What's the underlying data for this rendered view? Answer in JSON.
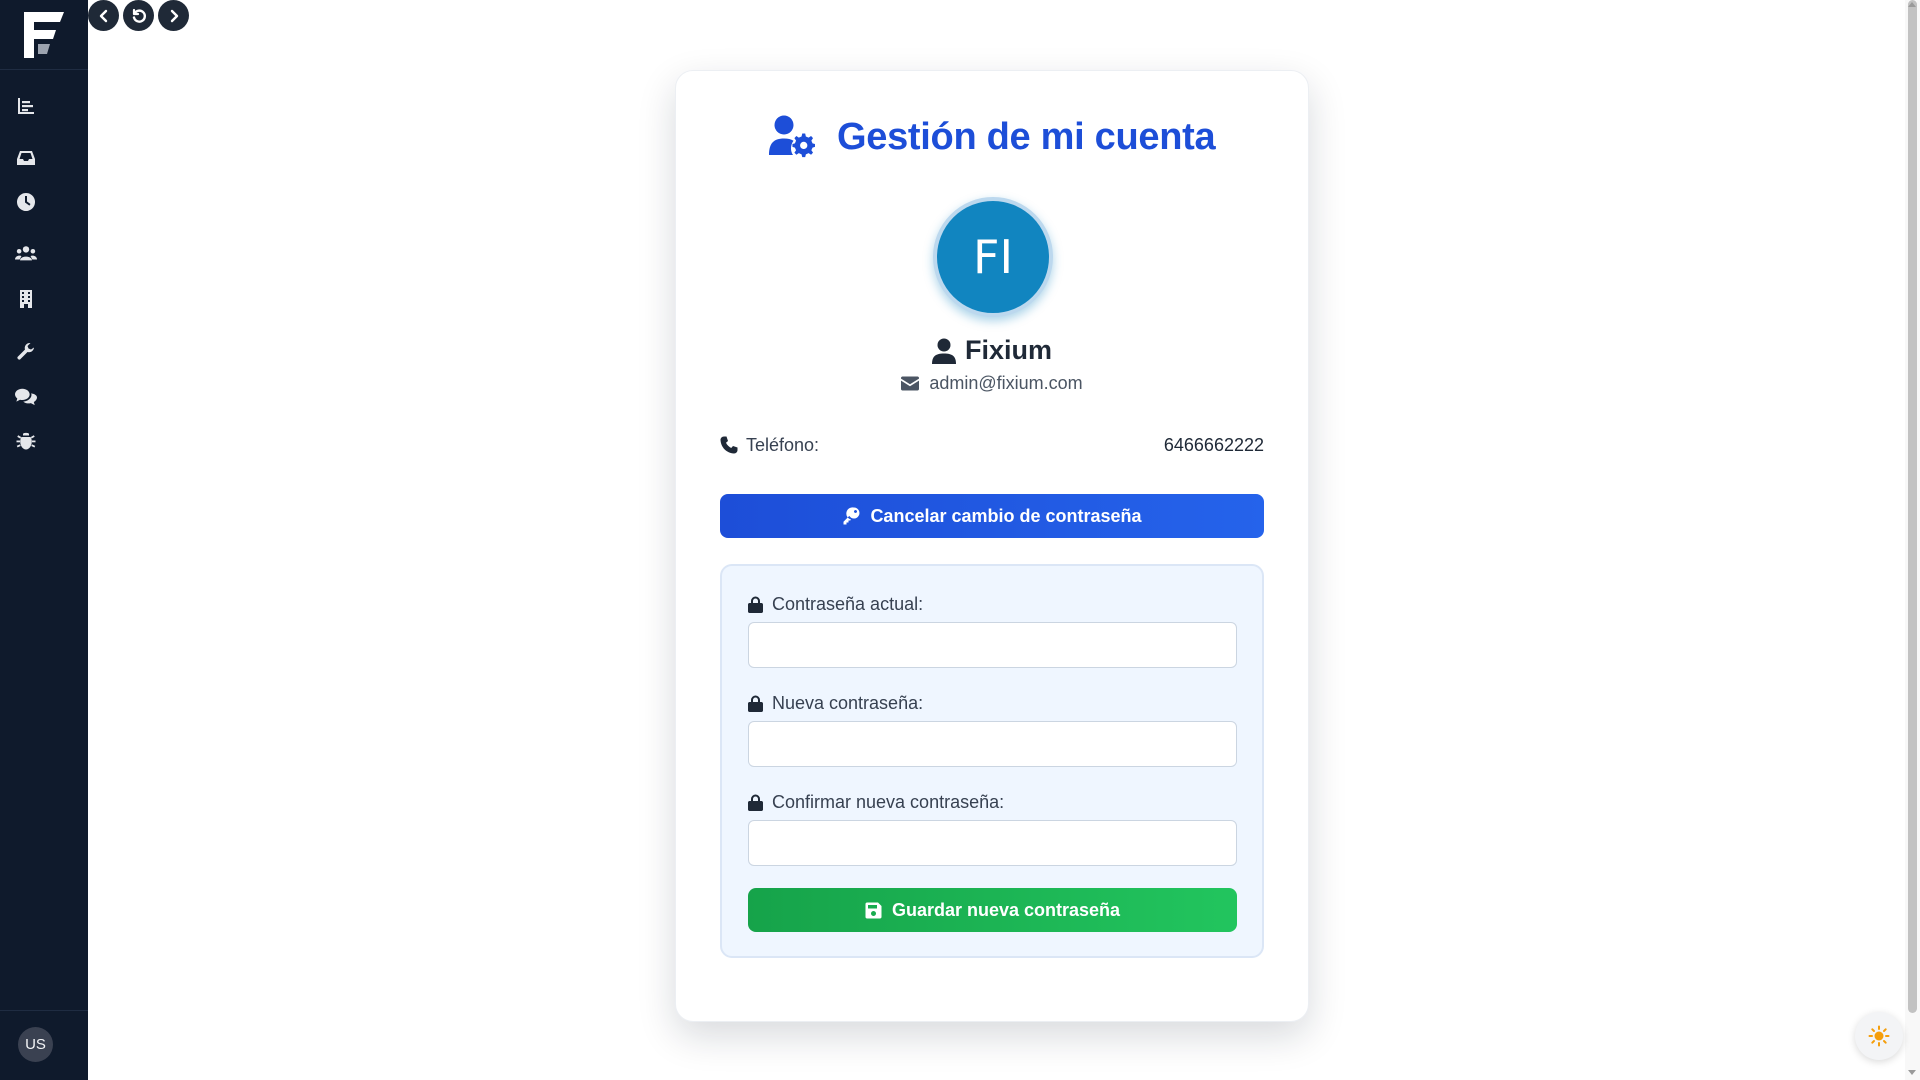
{
  "sidebar": {
    "logo_icon": "fixium-logo",
    "items": [
      {
        "name": "reports",
        "icon": "bar-chart-icon"
      },
      {
        "name": "inbox",
        "icon": "inbox-icon"
      },
      {
        "name": "history",
        "icon": "clock-icon"
      },
      {
        "name": "users",
        "icon": "users-icon"
      },
      {
        "name": "buildings",
        "icon": "building-icon"
      },
      {
        "name": "tools",
        "icon": "wrench-icon"
      },
      {
        "name": "chat",
        "icon": "chat-icon"
      },
      {
        "name": "bugs",
        "icon": "bug-icon"
      }
    ],
    "user_initials": "US"
  },
  "topnav": {
    "back_icon": "chevron-left-icon",
    "reload_icon": "reload-icon",
    "forward_icon": "chevron-right-icon"
  },
  "account": {
    "title": "Gestión de mi cuenta",
    "avatar_initials": "FI",
    "name": "Fixium",
    "email": "admin@fixium.com",
    "phone_label": "Teléfono:",
    "phone_value": "6466662222",
    "cancel_button": "Cancelar cambio de contraseña"
  },
  "password_form": {
    "current_label": "Contraseña actual:",
    "current_value": "",
    "new_label": "Nueva contraseña:",
    "new_value": "",
    "confirm_label": "Confirmar nueva contraseña:",
    "confirm_value": "",
    "save_button": "Guardar nueva contraseña"
  },
  "colors": {
    "sidebar_bg": "#0f1a2c",
    "primary": "#1d4ed8",
    "success": "#16a34a",
    "avatar_bg": "#1185c0"
  }
}
